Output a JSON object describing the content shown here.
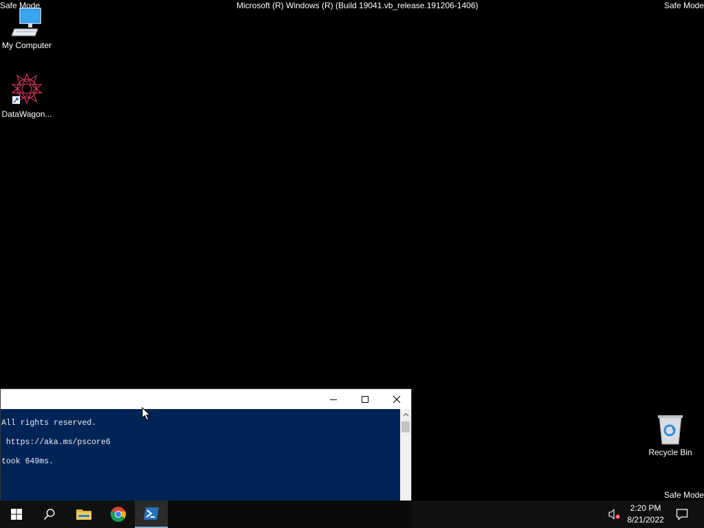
{
  "overlay": {
    "safe_mode_tl": "Safe Mode",
    "safe_mode_tr": "Safe Mode",
    "safe_mode_br": "Safe Mode",
    "build_string": "Microsoft (R) Windows (R) (Build 19041.vb_release.191206-1406)"
  },
  "desktop": {
    "icons": [
      {
        "label": "My Computer",
        "icon": "computer-icon"
      },
      {
        "label": "DataWagon...",
        "icon": "datawagon-app-icon"
      },
      {
        "label": "Recycle Bin",
        "icon": "recycle-bin-icon"
      }
    ]
  },
  "powershell_window": {
    "title": "",
    "lines": [
      "All rights reserved.",
      " https://aka.ms/pscore6",
      "took 649ms."
    ],
    "colors": {
      "background": "#012456",
      "text": "#eeedf0"
    }
  },
  "taskbar": {
    "items": [
      {
        "name": "start",
        "icon": "windows-logo-icon"
      },
      {
        "name": "search",
        "icon": "search-icon"
      },
      {
        "name": "file-explorer",
        "icon": "folder-icon"
      },
      {
        "name": "chrome",
        "icon": "chrome-icon"
      },
      {
        "name": "powershell",
        "icon": "powershell-icon",
        "active": true
      }
    ],
    "tray": {
      "time": "2:20 PM",
      "date": "8/21/2022",
      "volume_icon": "volume-muted-icon",
      "notification_icon": "action-center-icon"
    }
  }
}
